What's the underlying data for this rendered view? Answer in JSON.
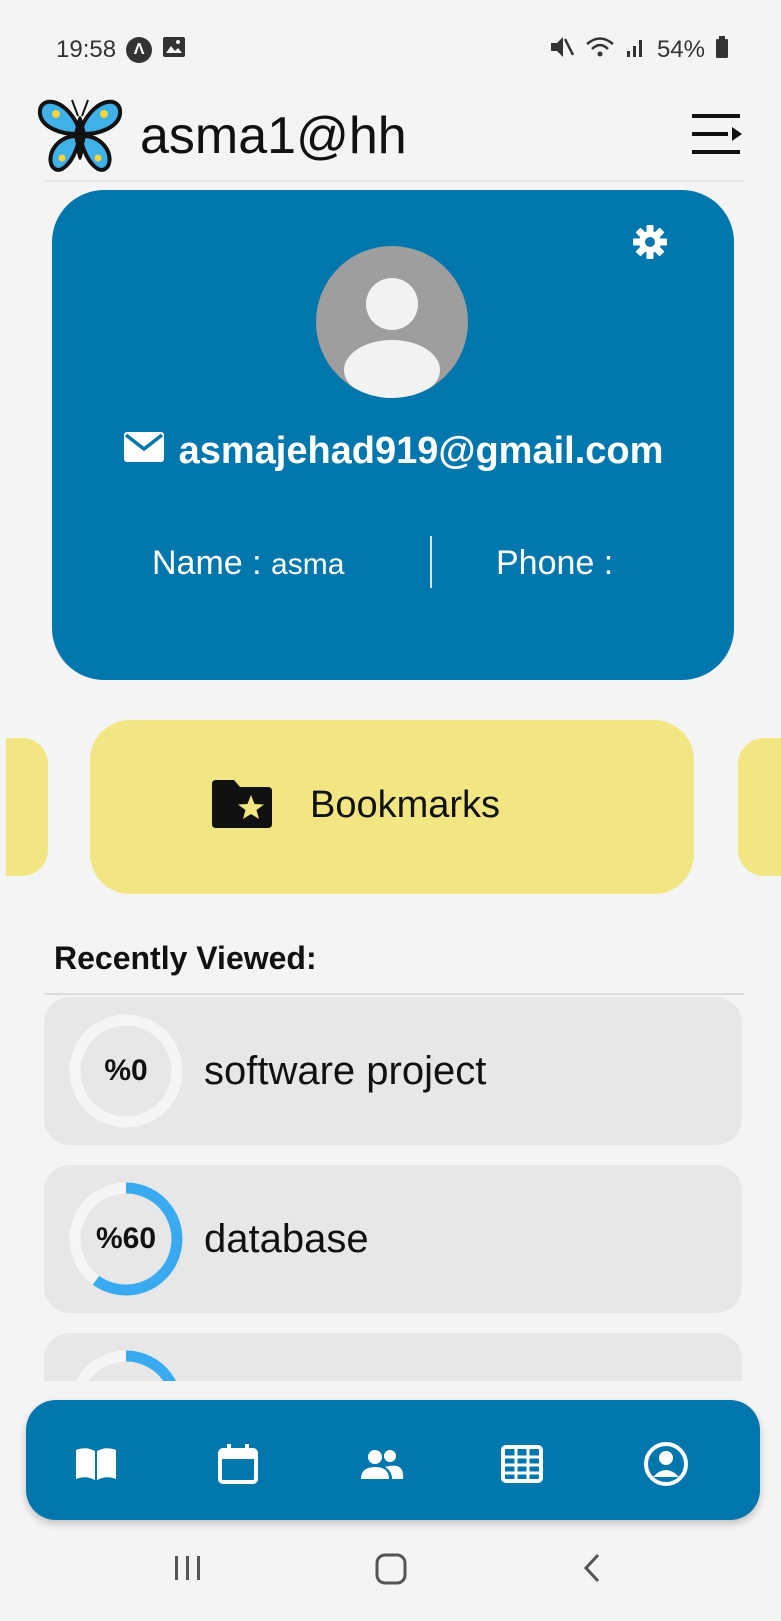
{
  "status_bar": {
    "time": "19:58",
    "battery": "54%"
  },
  "app_bar": {
    "title": "asma1@hh"
  },
  "profile": {
    "email": "asmajehad919@gmail.com",
    "name_label": "Name : ",
    "name_value": "asma",
    "phone_label": "Phone :"
  },
  "bookmarks": {
    "label": "Bookmarks"
  },
  "recently_viewed": {
    "title": "Recently Viewed:",
    "items": [
      {
        "progress_label": "%0",
        "progress": 0,
        "name": "software project"
      },
      {
        "progress_label": "%60",
        "progress": 60,
        "name": "database"
      },
      {
        "progress_label": "",
        "progress": 60,
        "name": ""
      }
    ]
  },
  "bottom_nav": {
    "items": [
      "book-icon",
      "calendar-icon",
      "people-icon",
      "table-icon",
      "account-icon"
    ]
  },
  "colors": {
    "primary": "#0277ad",
    "accent_yellow": "#f2e683",
    "progress_blue": "#3aaaf0",
    "item_bg": "#e7e7e7"
  }
}
